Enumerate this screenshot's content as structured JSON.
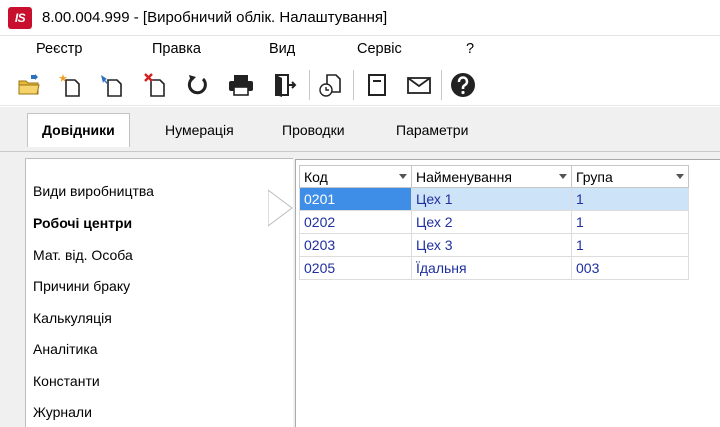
{
  "window": {
    "title": "8.00.004.999 - [Виробничий облік. Налаштування]",
    "app_icon_text": "IS"
  },
  "menu": [
    "Реєстр",
    "Правка",
    "Вид",
    "Сервіс",
    "?"
  ],
  "toolbar_icons": [
    "folder-open-icon",
    "new-document-icon",
    "copy-document-icon",
    "delete-document-icon",
    "refresh-icon",
    "print-icon",
    "exit-icon",
    "history-icon",
    "form-icon",
    "mail-icon",
    "help-icon"
  ],
  "tabs": [
    "Довідники",
    "Нумерація",
    "Проводки",
    "Параметри"
  ],
  "active_tab": "Довідники",
  "left_list": [
    "Види виробництва",
    "Робочі центри",
    "Мат. від. Особа",
    "Причини браку",
    "Калькуляція",
    "Аналітика",
    "Константи",
    "Журнали"
  ],
  "selected_left_item": "Робочі центри",
  "grid": {
    "columns": [
      "Код",
      "Найменування",
      "Група"
    ],
    "rows": [
      [
        "0201",
        "Цех 1",
        "1"
      ],
      [
        "0202",
        "Цех 2",
        "1"
      ],
      [
        "0203",
        "Цех 3",
        "1"
      ],
      [
        "0205",
        "Їдальня",
        "003"
      ]
    ],
    "selected_row": "0201"
  },
  "colors": {
    "brand": "#c8102e",
    "selection": "#cde3f7",
    "current_cell": "#3e8ee8",
    "cell_text": "#1f2fa0"
  }
}
